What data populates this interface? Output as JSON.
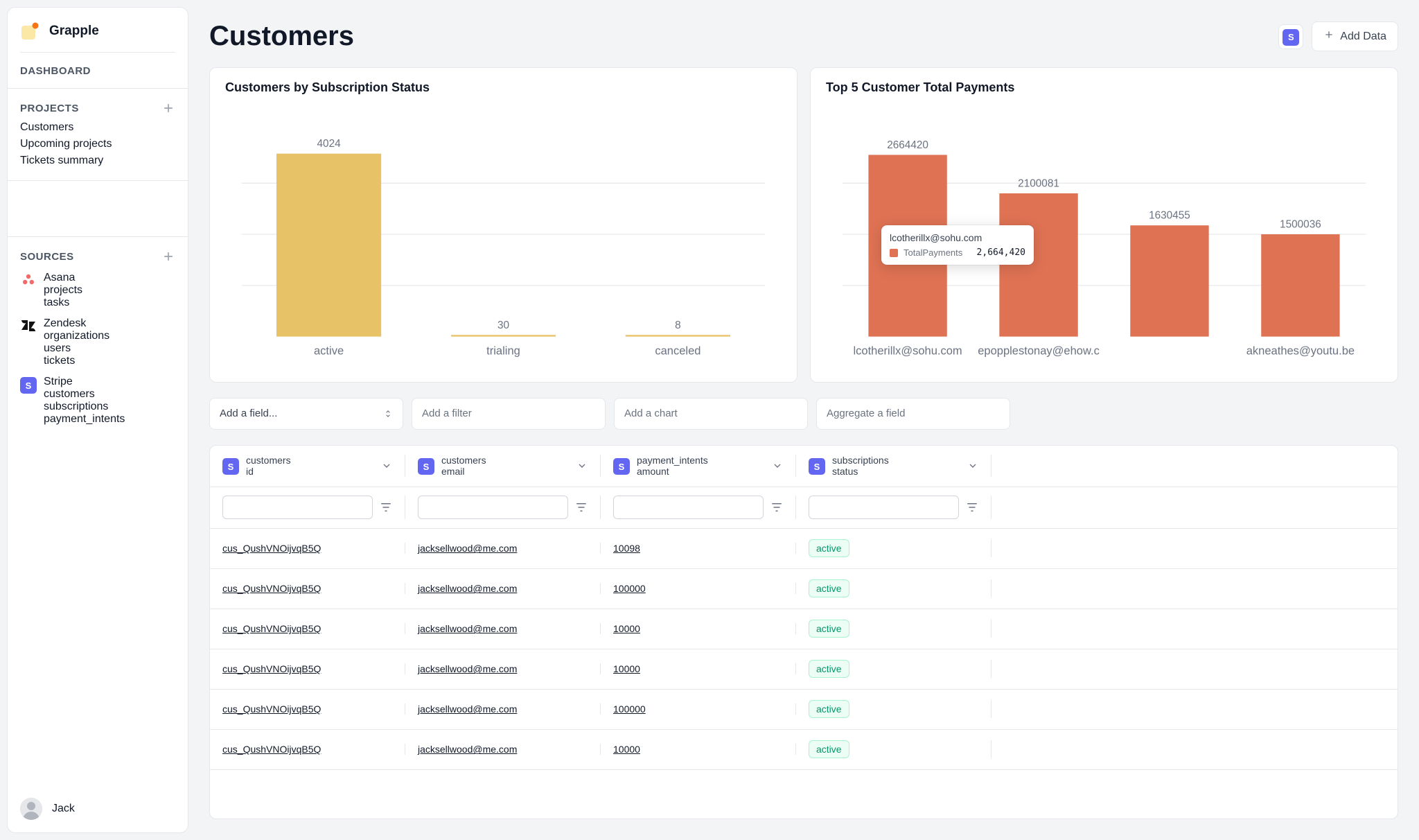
{
  "brand": {
    "name": "Grapple"
  },
  "sidebar": {
    "dashboard_label": "DASHBOARD",
    "projects_label": "PROJECTS",
    "projects": {
      "items": [
        "Customers",
        "Upcoming projects",
        "Tickets summary"
      ]
    },
    "sources_label": "SOURCES",
    "sources": {
      "asana": {
        "name": "Asana",
        "children": [
          "projects",
          "tasks"
        ]
      },
      "zendesk": {
        "name": "Zendesk",
        "children": [
          "organizations",
          "users",
          "tickets"
        ]
      },
      "stripe": {
        "name": "Stripe",
        "children": [
          "customers",
          "subscriptions",
          "payment_intents"
        ]
      }
    }
  },
  "profile": {
    "name": "Jack"
  },
  "header": {
    "title": "Customers",
    "add_data_label": "Add Data"
  },
  "colors": {
    "bar_yellow": "#e7c267",
    "bar_orange": "#df7253",
    "grid": "#e5e7eb"
  },
  "chart_data": [
    {
      "type": "bar",
      "title": "Customers by Subscription Status",
      "categories": [
        "active",
        "trialing",
        "canceled"
      ],
      "values": [
        4024,
        30,
        8
      ],
      "ylim": [
        0,
        4500
      ],
      "color": "#e7c267"
    },
    {
      "type": "bar",
      "title": "Top 5 Customer Total Payments",
      "categories": [
        "lcotherillx@sohu.com",
        "epopplestonay@ehow.c",
        "",
        "akneathes@youtu.be"
      ],
      "values": [
        2664420,
        2100081,
        1630455,
        1500036
      ],
      "ylim": [
        0,
        3000000
      ],
      "color": "#df7253",
      "tooltip": {
        "title": "lcotherillx@sohu.com",
        "key": "TotalPayments",
        "value": "2,664,420"
      }
    }
  ],
  "toolbar": {
    "add_field": "Add a field...",
    "add_filter_placeholder": "Add a filter",
    "add_chart_placeholder": "Add a chart",
    "aggregate_field_placeholder": "Aggregate a field"
  },
  "table": {
    "columns": [
      {
        "source": "customers",
        "field": "id"
      },
      {
        "source": "customers",
        "field": "email"
      },
      {
        "source": "payment_intents",
        "field": "amount"
      },
      {
        "source": "subscriptions",
        "field": "status"
      }
    ],
    "rows": [
      {
        "id": "cus_QushVNOijvqB5Q",
        "email": "jacksellwood@me.com",
        "amount": "10098",
        "status": "active"
      },
      {
        "id": "cus_QushVNOijvqB5Q",
        "email": "jacksellwood@me.com",
        "amount": "100000",
        "status": "active"
      },
      {
        "id": "cus_QushVNOijvqB5Q",
        "email": "jacksellwood@me.com",
        "amount": "10000",
        "status": "active"
      },
      {
        "id": "cus_QushVNOijvqB5Q",
        "email": "jacksellwood@me.com",
        "amount": "10000",
        "status": "active"
      },
      {
        "id": "cus_QushVNOijvqB5Q",
        "email": "jacksellwood@me.com",
        "amount": "100000",
        "status": "active"
      },
      {
        "id": "cus_QushVNOijvqB5Q",
        "email": "jacksellwood@me.com",
        "amount": "10000",
        "status": "active"
      }
    ]
  }
}
